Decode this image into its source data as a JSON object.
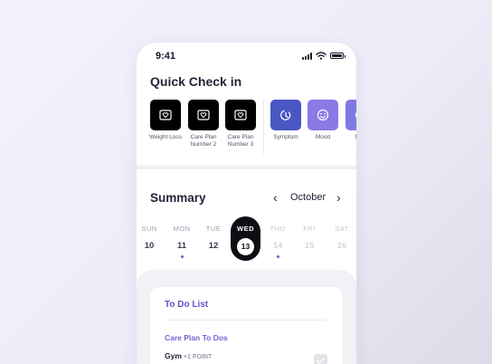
{
  "status_bar": {
    "time": "9:41"
  },
  "quick_check_in": {
    "title": "Quick Check in",
    "items": [
      {
        "label": "Weight Loss",
        "icon": "heart-frame-icon",
        "color": "#000000"
      },
      {
        "label": "Care Plan Number 2",
        "icon": "heart-frame-icon",
        "color": "#000000"
      },
      {
        "label": "Care Plan Number 3",
        "icon": "heart-frame-icon",
        "color": "#000000"
      },
      {
        "label": "Symptom",
        "icon": "symptom-icon",
        "color": "#4a57c2"
      },
      {
        "label": "Mood",
        "icon": "smiley-icon",
        "color": "#8a79e6"
      },
      {
        "label": "Med",
        "icon": "med-icon",
        "color": "#7f7ae0"
      }
    ]
  },
  "summary": {
    "title": "Summary",
    "month": "October",
    "days": [
      {
        "dow": "SUN",
        "num": "10",
        "dot": false,
        "state": "past"
      },
      {
        "dow": "MON",
        "num": "11",
        "dot": true,
        "state": "past"
      },
      {
        "dow": "TUE",
        "num": "12",
        "dot": false,
        "state": "past"
      },
      {
        "dow": "WED",
        "num": "13",
        "dot": false,
        "state": "selected"
      },
      {
        "dow": "THU",
        "num": "14",
        "dot": true,
        "state": "future"
      },
      {
        "dow": "FRI",
        "num": "15",
        "dot": false,
        "state": "future"
      },
      {
        "dow": "SAT",
        "num": "16",
        "dot": false,
        "state": "future"
      }
    ]
  },
  "todo": {
    "title": "To Do List",
    "section": "Care Plan To Dos",
    "items": [
      {
        "name": "Gym",
        "points": "+1 POINT",
        "checked": true
      }
    ]
  },
  "colors": {
    "accent": "#5c55c9",
    "dark": "#0d0d14"
  }
}
